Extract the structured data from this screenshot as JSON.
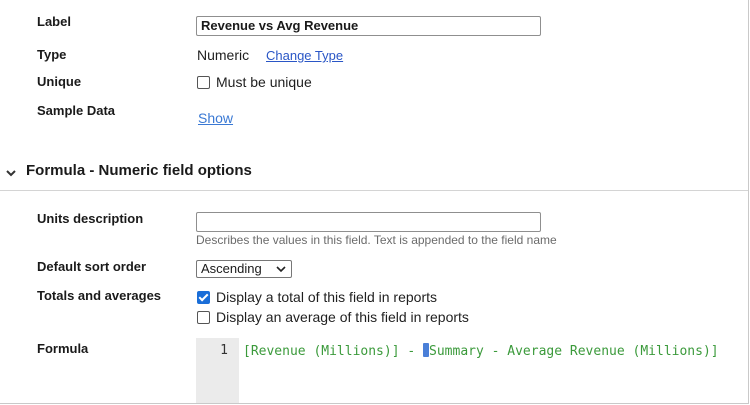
{
  "fields": {
    "label": {
      "label": "Label",
      "value": "Revenue vs Avg Revenue"
    },
    "type": {
      "label": "Type",
      "value": "Numeric",
      "change_link": "Change Type"
    },
    "unique": {
      "label": "Unique",
      "checkbox_label": "Must be unique",
      "checked": false
    },
    "sample_data": {
      "label": "Sample Data",
      "link": "Show"
    }
  },
  "section": {
    "title": "Formula - Numeric field options",
    "icon": "chevron-down-icon"
  },
  "options": {
    "units": {
      "label": "Units description",
      "value": "",
      "hint": "Describes the values in this field. Text is appended to the field name"
    },
    "sort": {
      "label": "Default sort order",
      "selected": "Ascending"
    },
    "totals": {
      "label": "Totals and averages",
      "total_label": "Display a total of this field in reports",
      "total_checked": true,
      "average_label": "Display an average of this field in reports",
      "average_checked": false
    },
    "formula": {
      "label": "Formula",
      "line_number": "1",
      "code_before": "[Revenue (Millions)] - ",
      "code_after": "Summary - Average Revenue (Millions)]"
    }
  },
  "colors": {
    "link": "#2a56c6",
    "code": "#3b9a3b",
    "checkbox": "#1a6ed8"
  }
}
